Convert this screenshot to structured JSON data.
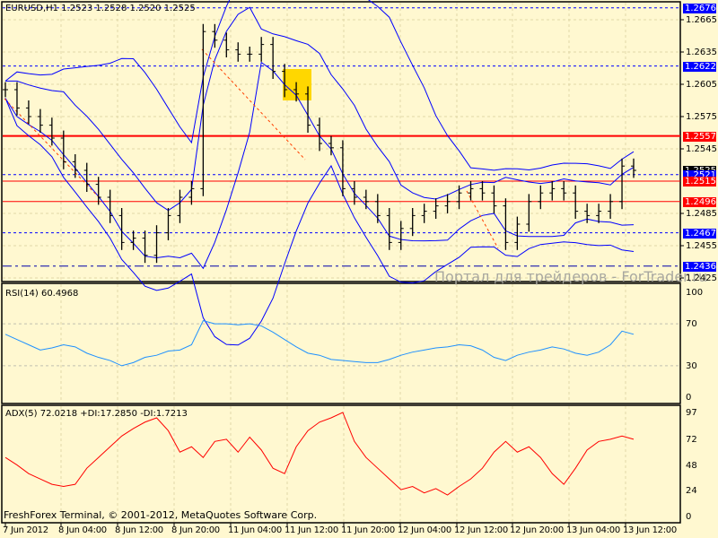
{
  "main_panel": {
    "header": "EURUSD,H1  1.2523 1.2528 1.2520 1.2525",
    "price_ticks": [
      "1.2665",
      "1.2635",
      "1.2605",
      "1.2575",
      "1.2545",
      "1.2485",
      "1.2455",
      "1.2425"
    ],
    "price_tick_values": [
      1.2665,
      1.2635,
      1.2605,
      1.2575,
      1.2545,
      1.2485,
      1.2455,
      1.2425
    ],
    "levels": [
      {
        "label": "1.2676",
        "value": 1.2676,
        "color": "#0000ff",
        "style": "dashed",
        "tag": "#0000ff"
      },
      {
        "label": "1.2622",
        "value": 1.2622,
        "color": "#0000ff",
        "style": "dashed",
        "tag": "#0000ff"
      },
      {
        "label": "1.2557",
        "value": 1.2557,
        "color": "#ff0000",
        "style": "thick",
        "tag": "#ff0000"
      },
      {
        "label": "1.2525",
        "value": 1.2525,
        "color": "none",
        "style": "none",
        "tag": "#000000"
      },
      {
        "label": "1.2521",
        "value": 1.2521,
        "color": "#0000ff",
        "style": "dashed",
        "tag": "#0000ff"
      },
      {
        "label": "1.2515",
        "value": 1.2515,
        "color": "#ff0000",
        "style": "solid",
        "tag": "#ff0000"
      },
      {
        "label": "1.2496",
        "value": 1.2496,
        "color": "#ff0000",
        "style": "solid",
        "tag": "#ff0000"
      },
      {
        "label": "1.2467",
        "value": 1.2467,
        "color": "#0000ff",
        "style": "dashed",
        "tag": "#0000ff"
      },
      {
        "label": "1.2436",
        "value": 1.2436,
        "color": "#0000aa",
        "style": "dashdot",
        "tag": "#0000ff"
      }
    ],
    "closes": [
      1.26,
      1.2583,
      1.2575,
      1.2567,
      1.2555,
      1.2533,
      1.2525,
      1.2512,
      1.25,
      1.2483,
      1.2458,
      1.2462,
      1.2446,
      1.2467,
      1.2483,
      1.25,
      1.2508,
      1.2654,
      1.2646,
      1.2637,
      1.2633,
      1.2633,
      1.2642,
      1.2617,
      1.26,
      1.2596,
      1.2567,
      1.255,
      1.2546,
      1.2508,
      1.25,
      1.2496,
      1.2483,
      1.2458,
      1.2471,
      1.2483,
      1.2487,
      1.2492,
      1.2496,
      1.2504,
      1.2508,
      1.2504,
      1.2492,
      1.2458,
      1.2475,
      1.2496,
      1.2504,
      1.2508,
      1.2504,
      1.2487,
      1.2483,
      1.2487,
      1.2496,
      1.2529,
      1.2525
    ],
    "watermark": "Портал для трейдеров - ForTrader.ru"
  },
  "rsi_panel": {
    "header": "RSI(14) 60.4968",
    "ticks": [
      "100",
      "70",
      "30",
      "0"
    ],
    "tick_values": [
      100,
      70,
      30,
      0
    ],
    "values": [
      60,
      55,
      50,
      45,
      47,
      50,
      48,
      42,
      38,
      35,
      30,
      33,
      38,
      40,
      44,
      45,
      50,
      73,
      70,
      70,
      69,
      70,
      68,
      62,
      55,
      48,
      42,
      40,
      36,
      35,
      34,
      33,
      33,
      36,
      40,
      43,
      45,
      47,
      48,
      50,
      49,
      45,
      38,
      35,
      40,
      43,
      45,
      48,
      46,
      42,
      40,
      43,
      50,
      63,
      60
    ]
  },
  "adx_panel": {
    "header": "ADX(5) 72.0218 +DI:17.2850 -DI:1.7213",
    "ticks": [
      "97",
      "72",
      "48",
      "24",
      "0"
    ],
    "tick_values": [
      97,
      72,
      48,
      24,
      0
    ],
    "values": [
      55,
      48,
      40,
      35,
      30,
      28,
      30,
      45,
      55,
      65,
      75,
      82,
      88,
      92,
      80,
      60,
      65,
      55,
      70,
      72,
      60,
      74,
      62,
      45,
      40,
      65,
      80,
      88,
      92,
      97,
      70,
      55,
      45,
      35,
      25,
      28,
      22,
      26,
      20,
      28,
      35,
      45,
      60,
      70,
      60,
      65,
      55,
      40,
      30,
      45,
      62,
      70,
      72,
      75,
      72
    ]
  },
  "time_axis": [
    "7 Jun 2012",
    "8 Jun 04:00",
    "8 Jun 12:00",
    "8 Jun 20:00",
    "11 Jun 04:00",
    "11 Jun 12:00",
    "11 Jun 20:00",
    "12 Jun 04:00",
    "12 Jun 12:00",
    "12 Jun 20:00",
    "13 Jun 04:00",
    "13 Jun 12:00"
  ],
  "footer": "FreshForex Terminal, © 2001-2012, MetaQuotes Software Corp.",
  "colors": {
    "background": "#fff8d0",
    "bars": "#000000",
    "bands": "#0000ff",
    "rsi": "#1e90ff",
    "adx": "#ff0000",
    "highlight": "#ffd700"
  }
}
